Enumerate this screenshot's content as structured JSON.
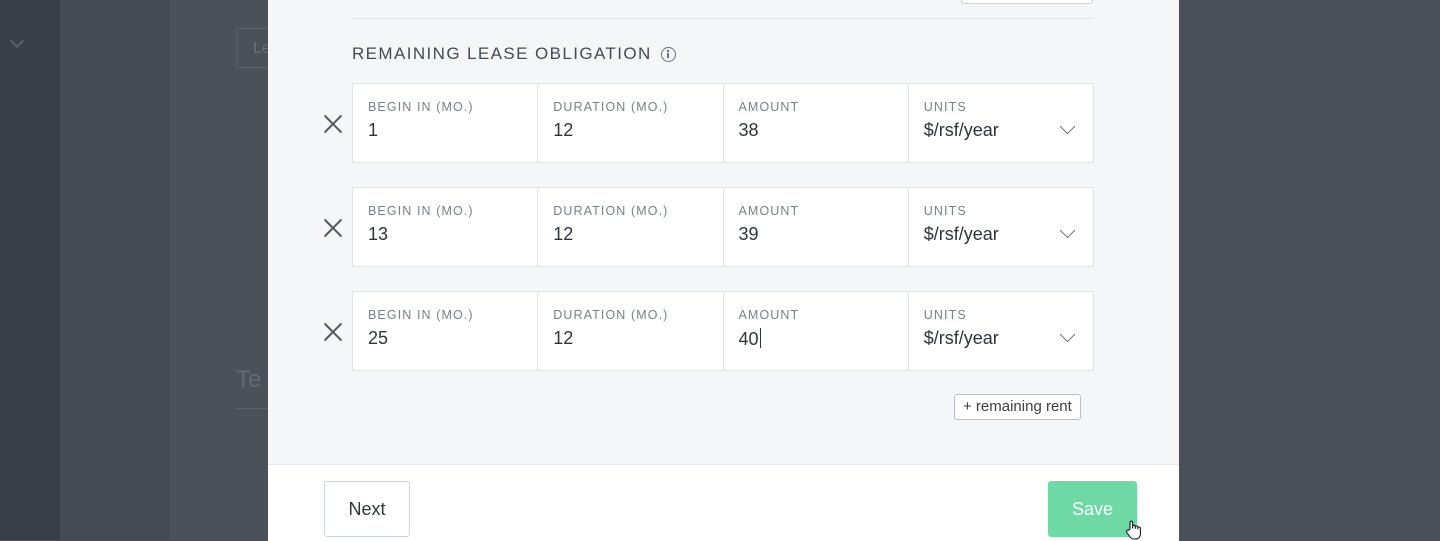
{
  "background": {
    "input_text": "Le",
    "heading_text": "Te"
  },
  "section": {
    "title": "REMAINING LEASE OBLIGATION"
  },
  "columns": [
    "BEGIN IN (MO.)",
    "DURATION (MO.)",
    "AMOUNT",
    "UNITS"
  ],
  "rows": [
    {
      "begin": "1",
      "duration": "12",
      "amount": "38",
      "units": "$/rsf/year"
    },
    {
      "begin": "13",
      "duration": "12",
      "amount": "39",
      "units": "$/rsf/year"
    },
    {
      "begin": "25",
      "duration": "12",
      "amount": "40",
      "units": "$/rsf/year"
    }
  ],
  "add_button_label": "+ remaining rent",
  "footer": {
    "next_label": "Next",
    "save_label": "Save"
  },
  "colors": {
    "save_accent": "#6fd9a6",
    "overlay": "#4a4f58"
  }
}
